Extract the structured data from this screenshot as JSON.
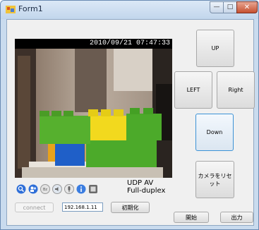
{
  "window": {
    "title": "Form1",
    "min_glyph": "—",
    "max_glyph": "□",
    "close_glyph": "✕"
  },
  "video": {
    "timestamp": "2010/09/21 07:47:33"
  },
  "status": {
    "line1": "UDP   AV",
    "line2": "Full-duplex"
  },
  "camera_toolbar": {
    "icons": [
      "search-icon",
      "users-icon",
      "mirror-icon",
      "speaker-icon",
      "microphone-icon",
      "info-icon",
      "fullscreen-icon"
    ]
  },
  "controls": {
    "up_label": "UP",
    "left_label": "LEFT",
    "right_label": "Right",
    "down_label": "Down",
    "reset_label": "カメラをリセット",
    "connect_label": "connect",
    "ip_value": "192.168.1.11",
    "init_label": "初期化",
    "start_label": "開始",
    "output_label": "出力"
  },
  "colors": {
    "accent_border": "#3c92d6",
    "lego_green": "#4caa2a",
    "lego_yellow": "#f2d91e",
    "lego_blue": "#1f5fc8",
    "lego_orange": "#e8a21c"
  }
}
